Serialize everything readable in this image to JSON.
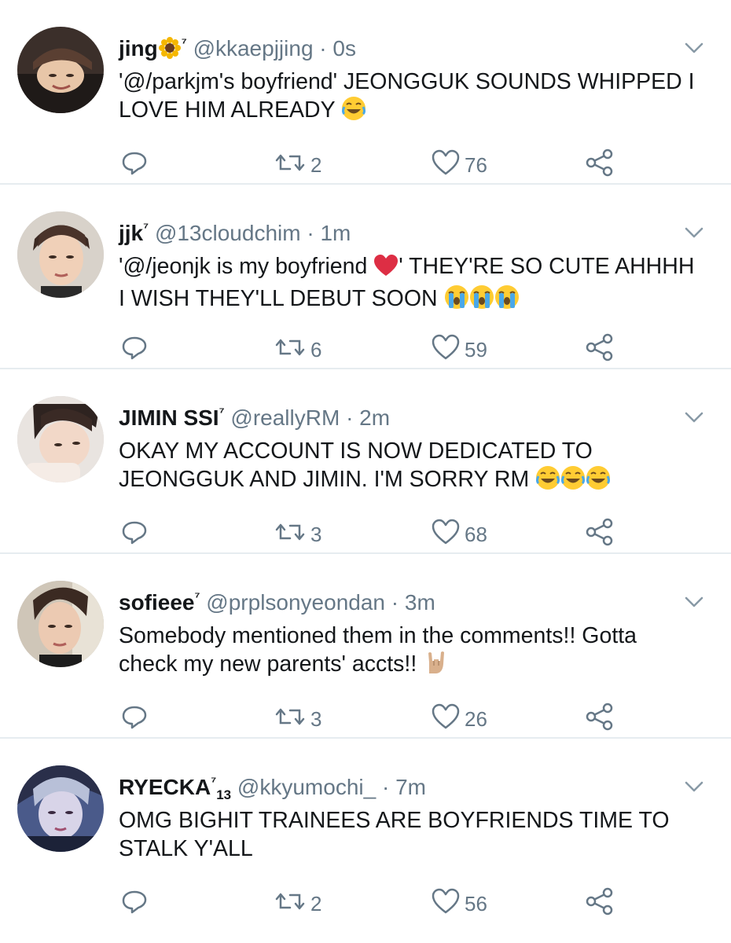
{
  "tweets": [
    {
      "name": "jing",
      "name_emoji": "sunflower",
      "name_suffix": "⁷",
      "handle": "@kkaepjjing",
      "time": "0s",
      "text_lines": [
        "'@/parkjm's boyfriend' JEONGGUK SOUNDS WHIPPED I",
        "LOVE HIM ALREADY"
      ],
      "trailing_emoji": [
        "joy"
      ],
      "replies": "",
      "retweets": "2",
      "likes": "76"
    },
    {
      "name": "jjk",
      "name_suffix": "⁷",
      "handle": "@13cloudchim",
      "time": "1m",
      "text_lines": [
        "'@/jeonjk is my boyfriend",
        "' THEY'RE SO CUTE AHHHH",
        "I WISH THEY'LL DEBUT SOON"
      ],
      "inline_emoji": "red-heart",
      "trailing_emoji": [
        "loudly-crying",
        "loudly-crying",
        "loudly-crying"
      ],
      "replies": "",
      "retweets": "6",
      "likes": "59"
    },
    {
      "name": "JIMIN SSI",
      "name_suffix": "⁷",
      "handle": "@reallyRM",
      "time": "2m",
      "text_lines": [
        "OKAY MY ACCOUNT IS NOW DEDICATED TO",
        "JEONGGUK AND JIMIN. I'M SORRY RM"
      ],
      "trailing_emoji": [
        "joy",
        "joy",
        "joy"
      ],
      "replies": "",
      "retweets": "3",
      "likes": "68"
    },
    {
      "name": "sofieee",
      "name_suffix": "⁷",
      "handle": "@prplsonyeondan",
      "time": "3m",
      "text_lines": [
        "Somebody mentioned them in the comments!! Gotta",
        "check my new parents' accts!!"
      ],
      "trailing_emoji": [
        "sign-of-horns"
      ],
      "replies": "",
      "retweets": "3",
      "likes": "26"
    },
    {
      "name": "RYECKA",
      "name_suffix": "⁷",
      "name_sub": "13",
      "handle": "@kkyumochi_",
      "time": "7m",
      "text_lines": [
        "OMG BIGHIT TRAINEES ARE BOYFRIENDS TIME TO",
        "STALK Y'ALL"
      ],
      "trailing_emoji": [],
      "replies": "",
      "retweets": "2",
      "likes": "56"
    }
  ],
  "separator": "·",
  "colors": {
    "text": "#14171a",
    "secondary": "#657786",
    "divider": "#e6ecf0",
    "heart": "#e0245e",
    "emoji_yellow": "#ffcc33",
    "tear_blue": "#4aa8e8"
  }
}
